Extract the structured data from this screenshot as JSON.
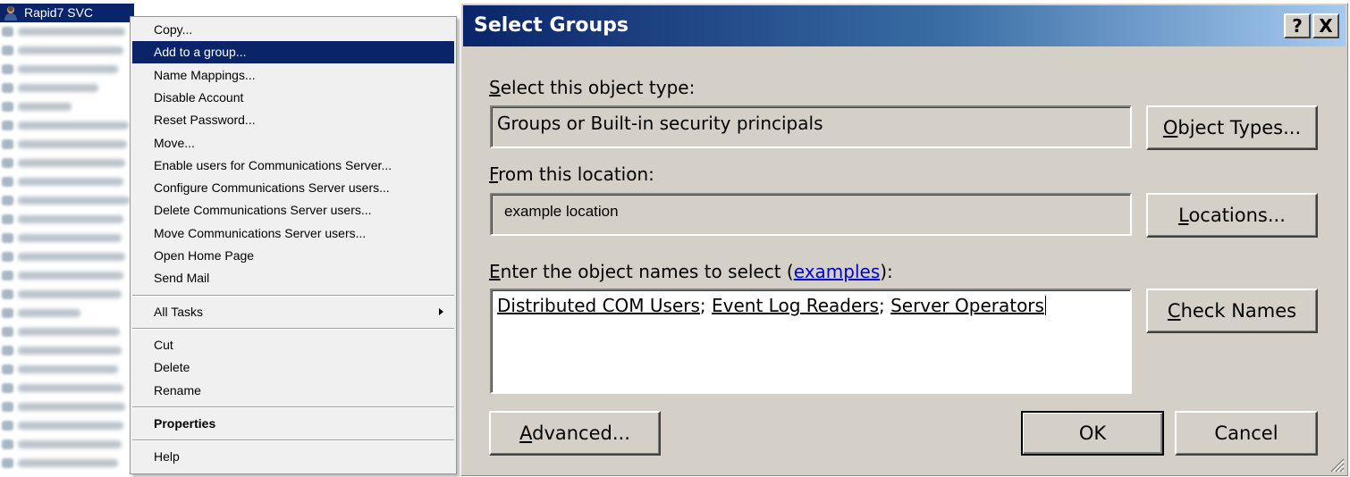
{
  "user_list": {
    "selected_user": "Rapid7 SVC",
    "selected_user_type": "User",
    "user_icon": "user-icon"
  },
  "context_menu": {
    "groups": [
      [
        "Copy...",
        "Add to a group...",
        "Name Mappings...",
        "Disable Account",
        "Reset Password...",
        "Move...",
        "Enable users for Communications Server...",
        "Configure Communications Server users...",
        "Delete Communications Server users...",
        "Move Communications Server users...",
        "Open Home Page",
        "Send Mail"
      ],
      [
        "All Tasks"
      ],
      [
        "Cut",
        "Delete",
        "Rename"
      ],
      [
        "Properties"
      ],
      [
        "Help"
      ]
    ],
    "highlighted_item": "Add to a group...",
    "bold_item": "Properties",
    "submenu_item": "All Tasks"
  },
  "dialog": {
    "title": "Select Groups",
    "help_button": "?",
    "close_button": "X",
    "object_type_label": {
      "mnemonic": "S",
      "rest": "elect this object type:"
    },
    "object_type_value": "Groups or Built-in security principals",
    "object_types_button": {
      "mnemonic": "O",
      "rest": "bject Types..."
    },
    "location_label": {
      "mnemonic": "F",
      "rest": "rom this location:"
    },
    "location_value": "example location",
    "locations_button": {
      "mnemonic": "L",
      "rest": "ocations..."
    },
    "names_label": {
      "mnemonic": "E",
      "rest": "nter the object names to select (",
      "link": "examples",
      "end": "):"
    },
    "names": [
      "Distributed COM Users",
      "Event Log Readers",
      "Server Operators"
    ],
    "separator": "; ",
    "check_names_button": {
      "mnemonic": "C",
      "rest": "heck Names"
    },
    "advanced_button": {
      "mnemonic": "A",
      "rest": "dvanced..."
    },
    "ok_button": "OK",
    "cancel_button": "Cancel"
  },
  "colors": {
    "menu_highlight": "#0a246a",
    "dialog_face": "#d4d0c8",
    "title_gradient_start": "#0a246a",
    "title_gradient_end": "#a6caf0",
    "link": "#0000cc"
  }
}
